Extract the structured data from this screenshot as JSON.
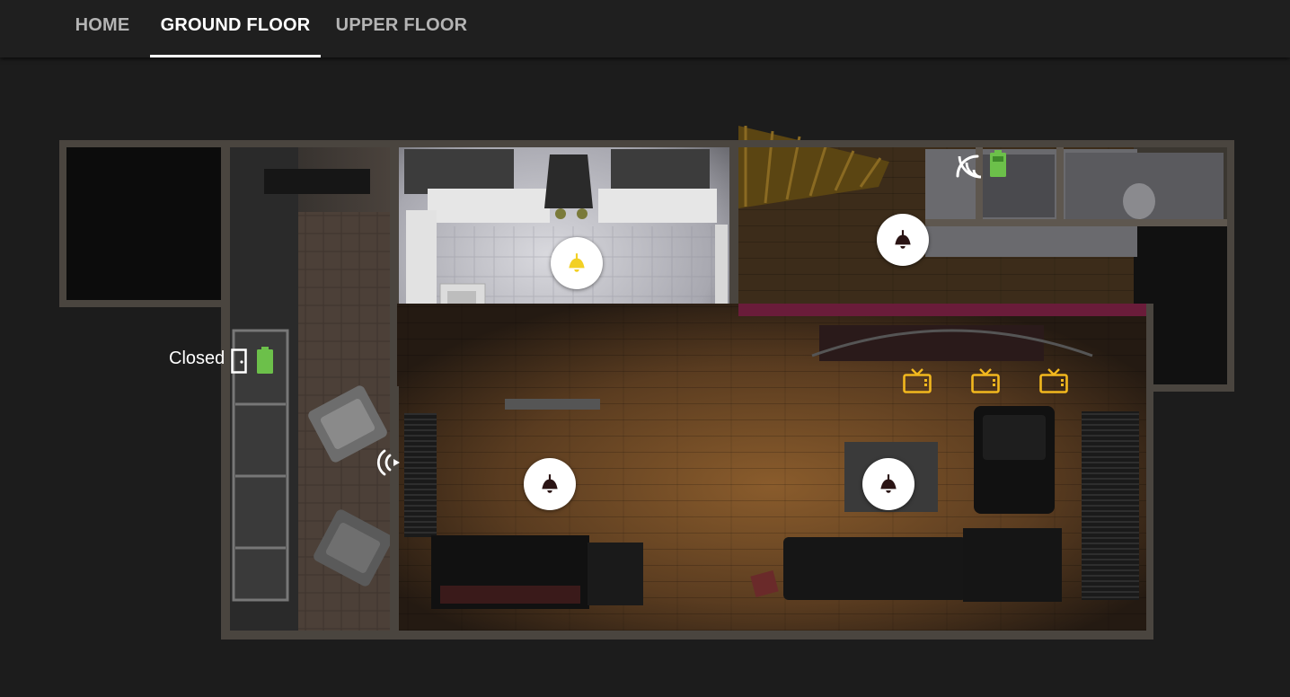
{
  "tabs": [
    {
      "label": "HOME",
      "active": false
    },
    {
      "label": "GROUND FLOOR",
      "active": true
    },
    {
      "label": "UPPER FLOOR",
      "active": false
    }
  ],
  "entrance_door": {
    "state": "Closed",
    "icon": "door-closed-icon",
    "battery_icon": "battery-full-icon"
  },
  "lights": [
    {
      "room": "kitchen",
      "state": "on",
      "icon": "ceiling-light-icon"
    },
    {
      "room": "hallway",
      "state": "off",
      "icon": "ceiling-light-icon"
    },
    {
      "room": "dining",
      "state": "off",
      "icon": "ceiling-light-icon"
    },
    {
      "room": "living",
      "state": "off",
      "icon": "ceiling-light-icon"
    }
  ],
  "media_players": [
    {
      "icon": "tv-icon",
      "state": "on"
    },
    {
      "icon": "tv-icon",
      "state": "on"
    },
    {
      "icon": "tv-icon",
      "state": "on"
    }
  ],
  "sensors": [
    {
      "icon": "wifi-signal-icon",
      "location": "upper-right"
    },
    {
      "icon": "wifi-signal-icon",
      "location": "living-room-left"
    }
  ],
  "colors": {
    "background": "#1c1c1c",
    "tabbar": "#1f1f1f",
    "light_on": "#f2d024",
    "light_off": "#2a1414",
    "tv": "#f2b81e",
    "battery": "#6cc04a"
  }
}
